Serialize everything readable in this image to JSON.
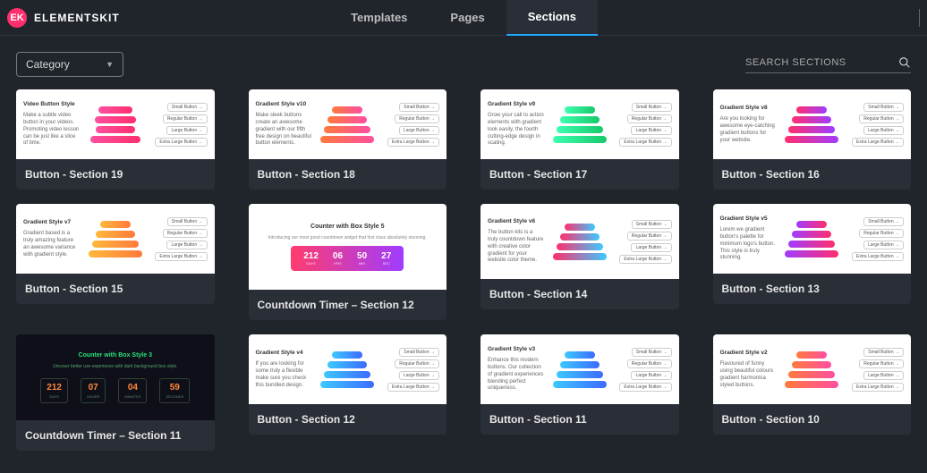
{
  "brand": "ELEMENTSKIT",
  "logo_initials": "EK",
  "tabs": {
    "templates": "Templates",
    "pages": "Pages",
    "sections": "Sections"
  },
  "category_label": "Category",
  "search_placeholder": "SEARCH SECTIONS",
  "thumb_text": {
    "video_button": "Video Button Style",
    "grad_v10": "Gradient Style v10",
    "grad_v9": "Gradient Style v9",
    "grad_v8": "Gradient Style v8",
    "grad_v7": "Gradient Style v7",
    "grad_v6": "Gradient Style v6",
    "grad_v5": "Gradient Style v5",
    "grad_v4": "Gradient Style v4",
    "grad_v3": "Gradient Style v3",
    "grad_v2": "Gradient Style v2",
    "cd5_title": "Counter with Box Style 5",
    "cd5_sub": "Introducing our most good countdown widget that first class absolutely stunning.",
    "cd3_title": "Counter with Box Style 3",
    "cd3_sub": "Uncover better use experience with dark background box style."
  },
  "outline_btns": {
    "small": "Small Button →",
    "regular": "Regular Button →",
    "large": "Large Button →",
    "xlarge": "Extra Large Button →"
  },
  "countdown5": {
    "d": "212",
    "h": "06",
    "m": "50",
    "s": "27",
    "dl": "DAYS",
    "hl": "HRS",
    "ml": "MIN",
    "sl": "SEC"
  },
  "countdown3": {
    "d": "212",
    "h": "07",
    "m": "04",
    "s": "59",
    "dl": "DAYS",
    "hl": "HOURS",
    "ml": "MINUTES",
    "sl": "SECONDS"
  },
  "cards": {
    "c19": "Button - Section 19",
    "c18": "Button - Section 18",
    "c17": "Button - Section 17",
    "c16": "Button - Section 16",
    "c15": "Button - Section 15",
    "cd12": "Countdown Timer – Section 12",
    "c14": "Button - Section 14",
    "c13": "Button - Section 13",
    "cd11": "Countdown Timer – Section 11",
    "c12": "Button - Section 12",
    "c11": "Button - Section 11",
    "c10": "Button - Section 10"
  }
}
